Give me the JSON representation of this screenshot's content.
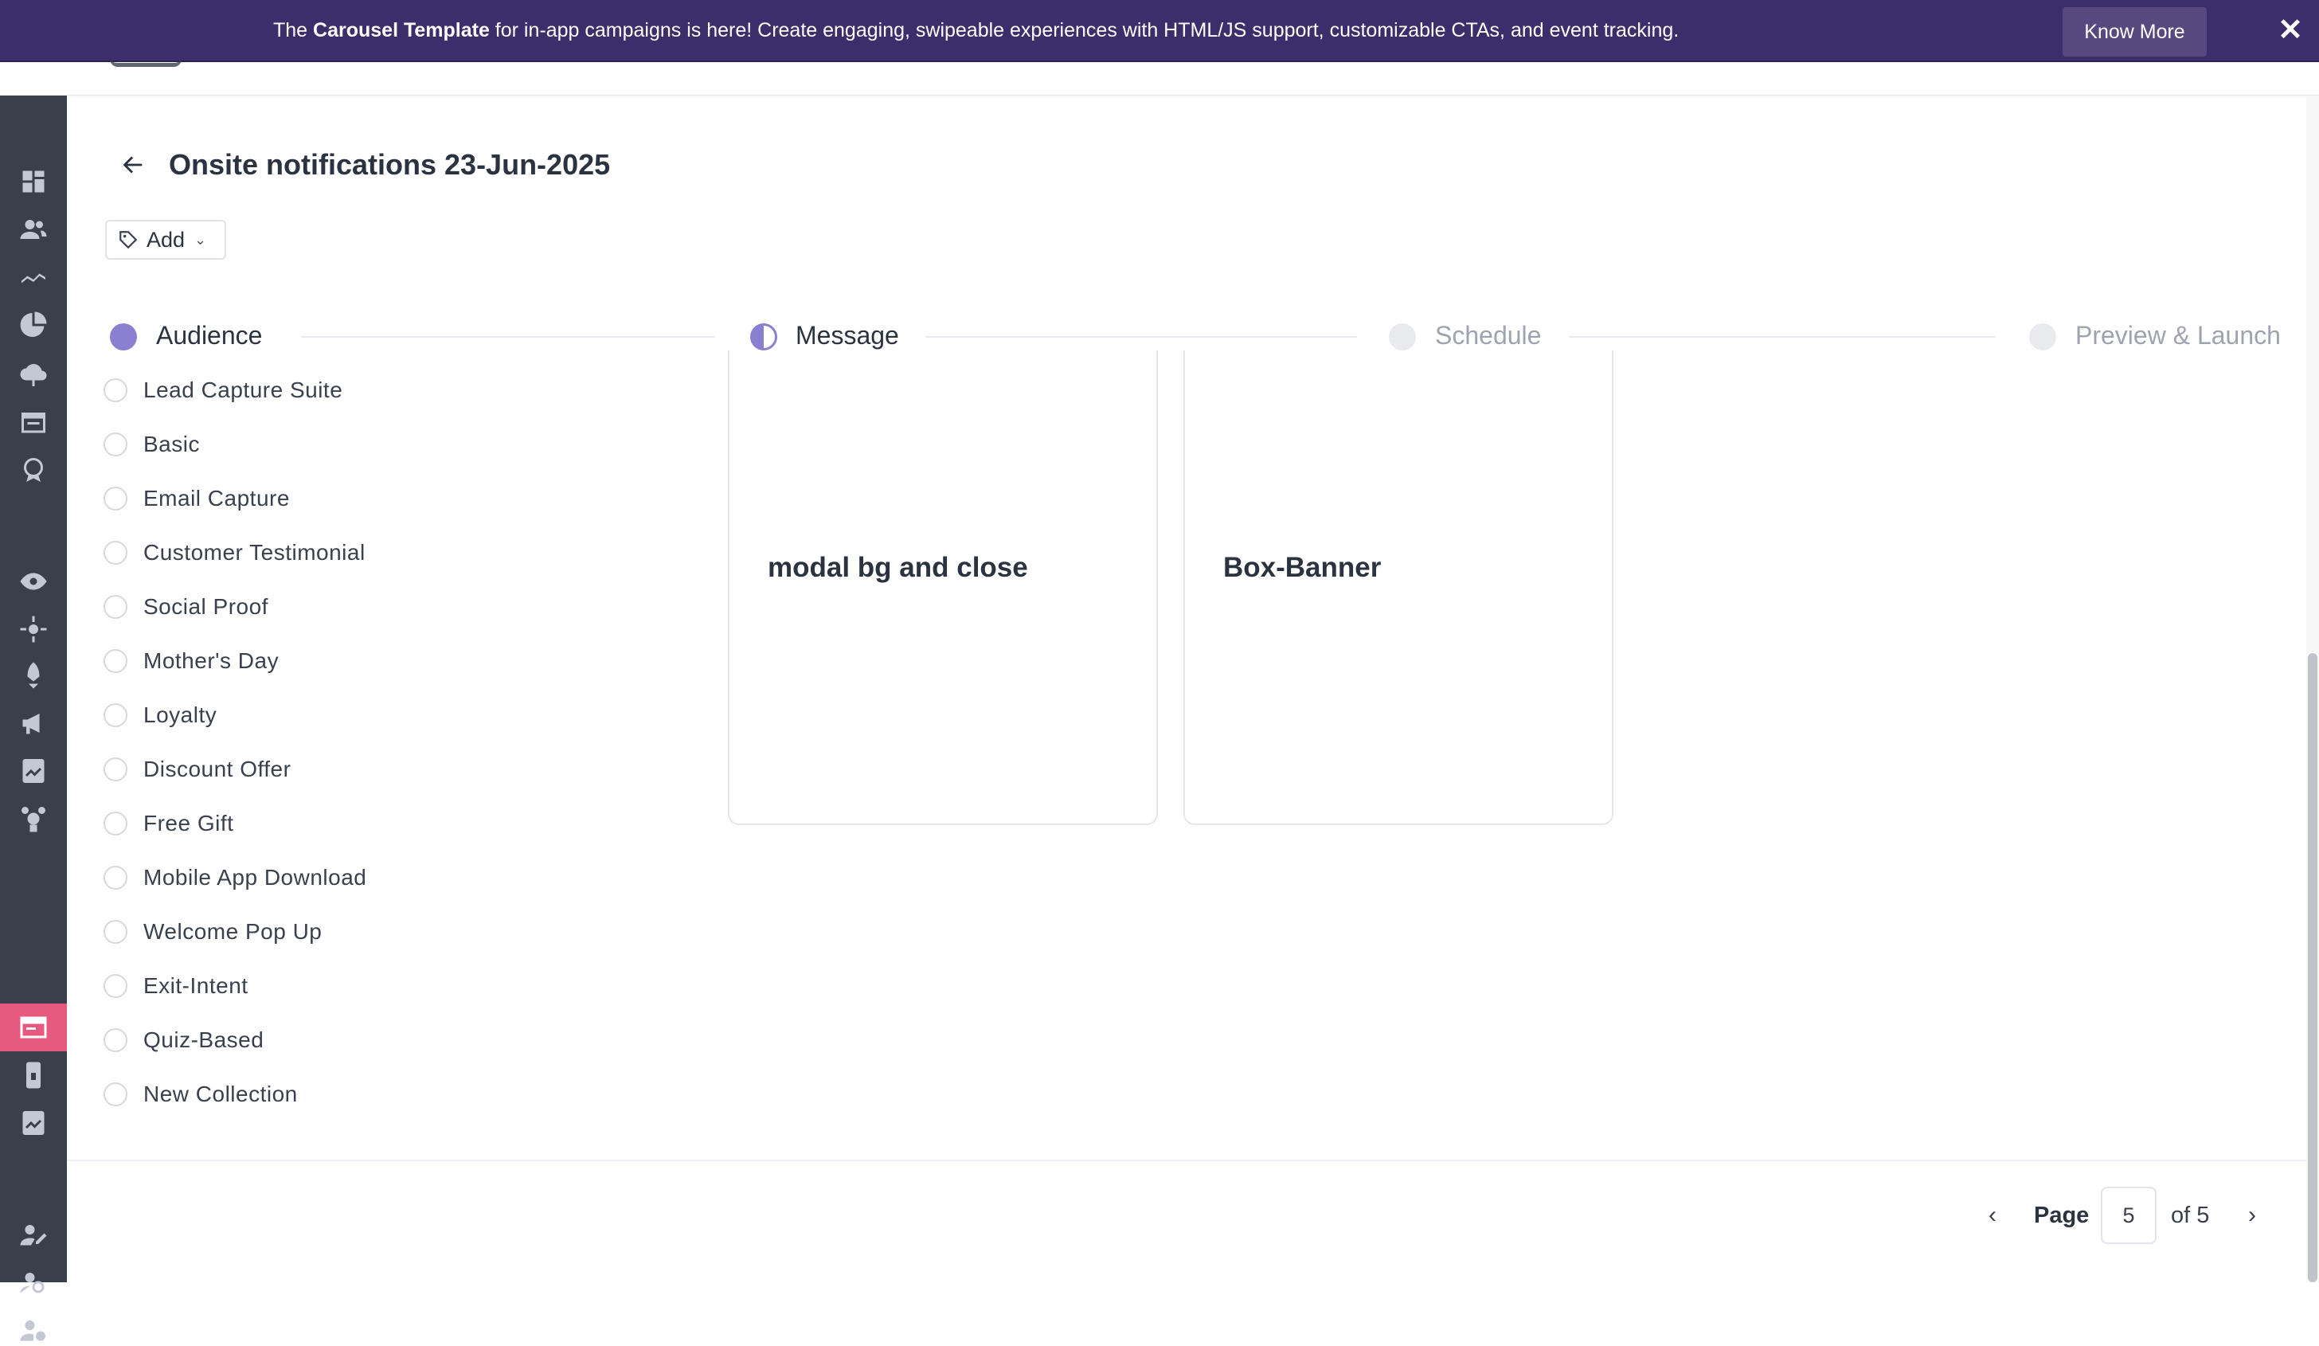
{
  "banner": {
    "prefix": "The ",
    "highlight": "Carousel Template",
    "suffix": " for in-app campaigns is here! Create engaging, swipeable experiences with HTML/JS support, customizable CTAs, and event tracking.",
    "button": "Know More",
    "close_icon": "close-icon"
  },
  "page": {
    "title": "Onsite notifications 23-Jun-2025",
    "tag_button": "Add"
  },
  "steps": [
    {
      "label": "Audience",
      "state": "complete"
    },
    {
      "label": "Message",
      "state": "in-progress"
    },
    {
      "label": "Schedule",
      "state": "pending"
    },
    {
      "label": "Preview & Launch",
      "state": "pending"
    }
  ],
  "categories": [
    "Lead Capture Suite",
    "Basic",
    "Email Capture",
    "Customer Testimonial",
    "Social Proof",
    "Mother's Day",
    "Loyalty",
    "Discount Offer",
    "Free Gift",
    "Mobile App Download",
    "Welcome Pop Up",
    "Exit-Intent",
    "Quiz-Based",
    "New Collection"
  ],
  "templates": [
    {
      "title": "modal bg and close"
    },
    {
      "title": "Box-Banner"
    }
  ],
  "pagination": {
    "label": "Page",
    "current": "5",
    "total_text": "of 5"
  },
  "colors": {
    "banner_bg": "#3b2e6b",
    "accent": "#8b7fd1",
    "active_nav": "#e75a80",
    "sidebar_bg": "#3a3f4b"
  }
}
